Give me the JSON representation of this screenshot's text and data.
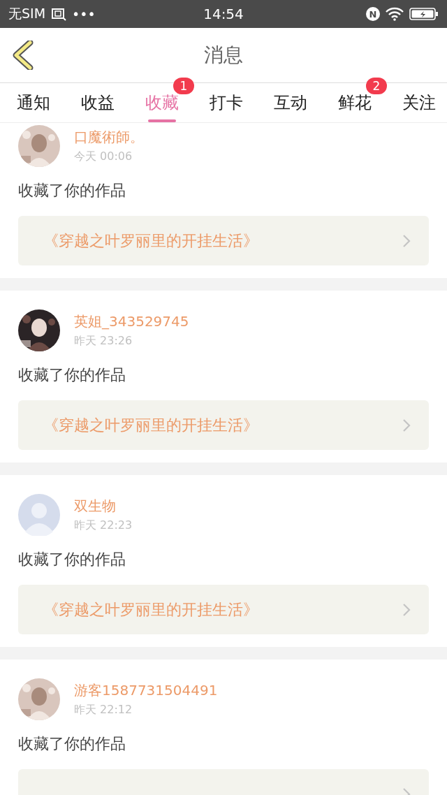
{
  "status_bar": {
    "carrier": "无SIM",
    "dots": "•••",
    "time": "14:54",
    "nfc": "N"
  },
  "header": {
    "title": "消息"
  },
  "tabs": [
    {
      "label": "通知",
      "selected": false
    },
    {
      "label": "收益",
      "selected": false
    },
    {
      "label": "收藏",
      "selected": true,
      "badge": "1"
    },
    {
      "label": "打卡",
      "selected": false
    },
    {
      "label": "互动",
      "selected": false
    },
    {
      "label": "鲜花",
      "selected": false,
      "badge": "2"
    },
    {
      "label": "关注",
      "selected": false
    }
  ],
  "messages": [
    {
      "user": "口魔術師。",
      "time": "今天 00:06",
      "text": "收藏了你的作品",
      "work": "《穿越之叶罗丽里的开挂生活》"
    },
    {
      "user": "英姐_343529745",
      "time": "昨天 23:26",
      "text": "收藏了你的作品",
      "work": "《穿越之叶罗丽里的开挂生活》"
    },
    {
      "user": "双生物",
      "time": "昨天 22:23",
      "text": "收藏了你的作品",
      "work": "《穿越之叶罗丽里的开挂生活》",
      "avatar": {
        "kind": "default"
      }
    },
    {
      "user": "游客1587731504491",
      "time": "昨天 22:12",
      "text": "收藏了你的作品"
    }
  ]
}
